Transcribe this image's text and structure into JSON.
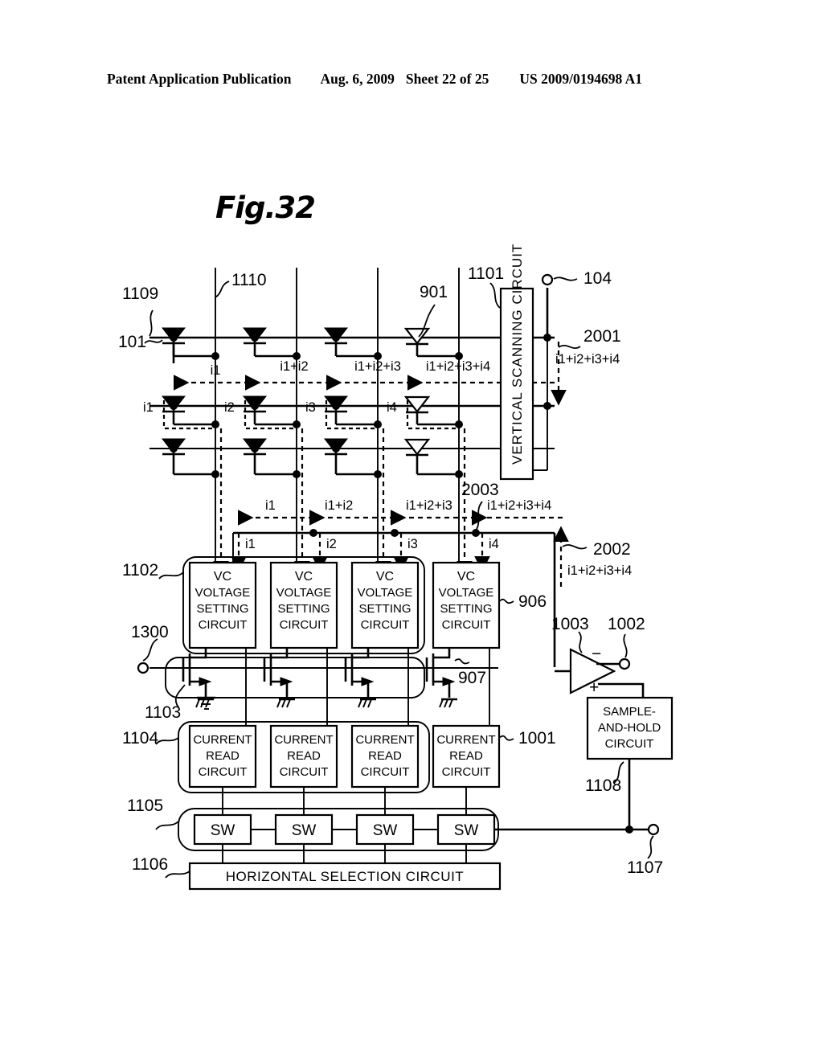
{
  "header": {
    "publication": "Patent Application Publication",
    "date": "Aug. 6, 2009",
    "sheet": "Sheet 22 of 25",
    "patent_number": "US 2009/0194698 A1"
  },
  "figure": {
    "title": "Fig.32"
  },
  "blocks": {
    "vertical_scanning_circuit": "VERTICAL SCANNING CIRCUIT",
    "vc_line1": "VC",
    "vc_line2": "VOLTAGE",
    "vc_line3": "SETTING",
    "vc_line4": "CIRCUIT",
    "current_read_line1": "CURRENT",
    "current_read_line2": "READ",
    "current_read_line3": "CIRCUIT",
    "sample_hold_line1": "SAMPLE-",
    "sample_hold_line2": "AND-HOLD",
    "sample_hold_line3": "CIRCUIT",
    "switch_label": "SW",
    "horizontal_selection_circuit": "HORIZONTAL SELECTION CIRCUIT"
  },
  "reference_numerals": {
    "n1109": "1109",
    "n1110": "1110",
    "n101": "101",
    "n901": "901",
    "n1101": "1101",
    "n104": "104",
    "n2001": "2001",
    "n2003": "2003",
    "n2002": "2002",
    "n1102": "1102",
    "n1300": "1300",
    "n1103": "1103",
    "n1104": "1104",
    "n1105": "1105",
    "n1106": "1106",
    "n906": "906",
    "n907": "907",
    "n1001": "1001",
    "n1002": "1002",
    "n1003": "1003",
    "n1108": "1108",
    "n1107": "1107"
  },
  "currents": {
    "i1": "i1",
    "i2": "i2",
    "i3": "i3",
    "i4": "i4",
    "sum1": "i1",
    "sum2": "i1+i2",
    "sum3": "i1+i2+i3",
    "sum4": "i1+i2+i3+i4"
  },
  "amplifier": {
    "minus": "−",
    "plus": "+"
  }
}
